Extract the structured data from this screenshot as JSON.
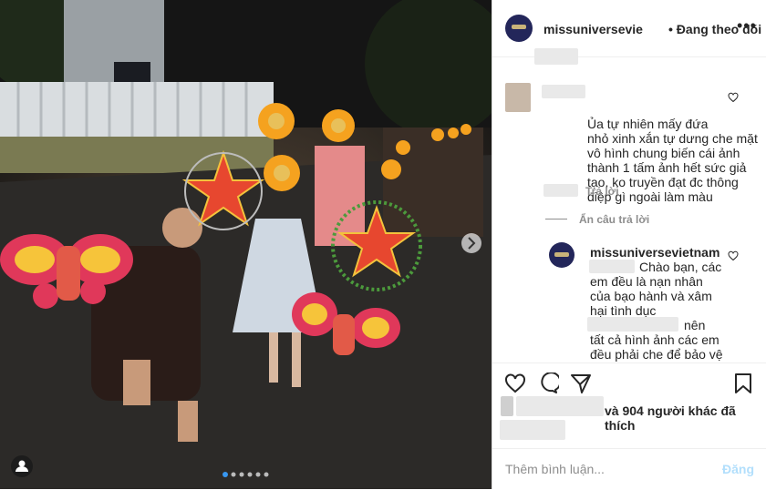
{
  "post": {
    "username": "missuniversevie",
    "follow_status": "• Đang theo dõi",
    "more_label": "•••",
    "carousel_dots": 6,
    "carousel_active": 1
  },
  "comments": [
    {
      "text": "Ủa tự nhiên mấy đứa\nnhỏ xinh xắn tự dưng che mặt\nvô hình chung biến cái ảnh\nthành 1 tấm ảnh hết sức giả\ntạo, ko truyền đạt đc thông\nđiệp gì ngoài làm màu",
      "reply_label": "Trả lời",
      "hide_replies_label": "Ẩn câu trả lời"
    }
  ],
  "reply": {
    "username": "missuniversevietnam",
    "line1": "Chào bạn, các",
    "line2": "em đều là nạn nhân",
    "line3": "của bạo hành và xâm",
    "line4": "hại tình dục",
    "line5": "nên",
    "line6": "tất cả hình ảnh các em",
    "line7": "đều phải che để bảo vệ"
  },
  "likes_text": "và 904 người khác đã thích",
  "comment_input": {
    "placeholder": "Thêm bình luận...",
    "post_label": "Đăng"
  },
  "colors": {
    "accent_post": "#b2dffc",
    "text": "#262626",
    "meta": "#8e8e8e"
  }
}
